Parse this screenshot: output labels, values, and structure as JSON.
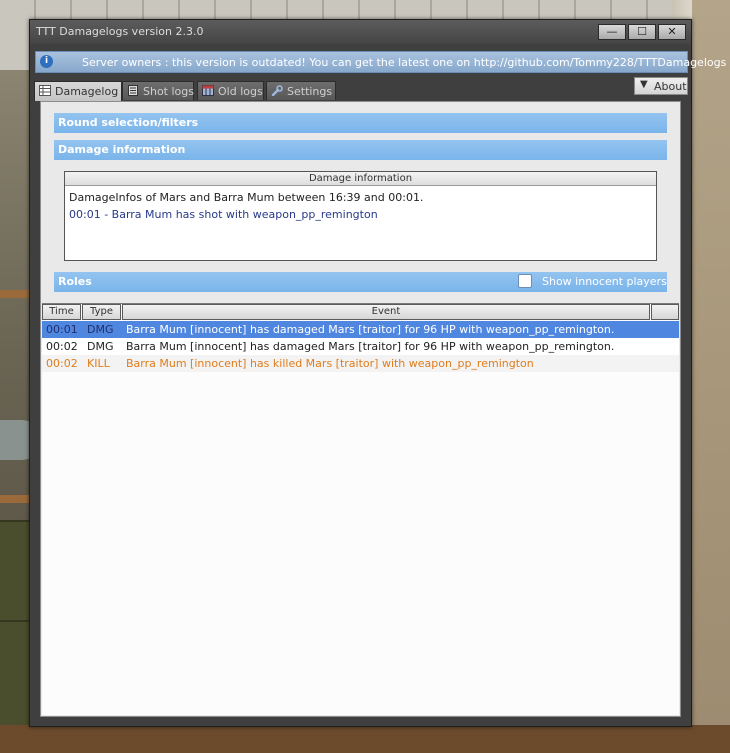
{
  "window": {
    "title": "TTT Damagelogs version 2.3.0",
    "minimize_symbol": "—",
    "maximize_symbol": "☐",
    "close_symbol": "✕"
  },
  "notice": {
    "icon": "info-icon",
    "icon_glyph": "i",
    "text": "Server owners : this version is outdated! You can get the latest one on http://github.com/Tommy228/TTTDamagelogs"
  },
  "tabs": [
    {
      "label": "Damagelog",
      "icon": "table-icon",
      "active": true
    },
    {
      "label": "Shot logs",
      "icon": "document-icon",
      "active": false
    },
    {
      "label": "Old logs",
      "icon": "calendar-icon",
      "active": false
    },
    {
      "label": "Settings",
      "icon": "wrench-icon",
      "active": false
    }
  ],
  "about": {
    "arrow": "▼",
    "label": "About"
  },
  "sections": {
    "round_filters": "Round selection/filters",
    "damage_information": "Damage information",
    "roles": "Roles",
    "show_innocent_label": "Show innocent players"
  },
  "damage_info": {
    "header": "Damage information",
    "line1": "DamageInfos of Mars and Barra Mum between 16:39 and 00:01.",
    "line2": "00:01 - Barra Mum has shot with weapon_pp_remington"
  },
  "table": {
    "columns": [
      "Time",
      "Type",
      "Event",
      ""
    ],
    "rows": [
      {
        "time": "00:01",
        "type": "DMG",
        "event": "Barra Mum [innocent] has damaged Mars [traitor] for 96 HP with weapon_pp_remington.",
        "selected": true
      },
      {
        "time": "00:02",
        "type": "DMG",
        "event": "Barra Mum [innocent] has damaged Mars [traitor] for 96 HP with weapon_pp_remington.",
        "selected": false
      },
      {
        "time": "00:02",
        "type": "KILL",
        "event": "Barra Mum [innocent] has killed Mars [traitor] with weapon_pp_remington",
        "selected": false
      }
    ]
  },
  "colors": {
    "accent_bar": "#7ab4ea",
    "selected_row": "#4f86e0",
    "kill_text": "#e07d1c",
    "info_text": "#283a8a"
  }
}
